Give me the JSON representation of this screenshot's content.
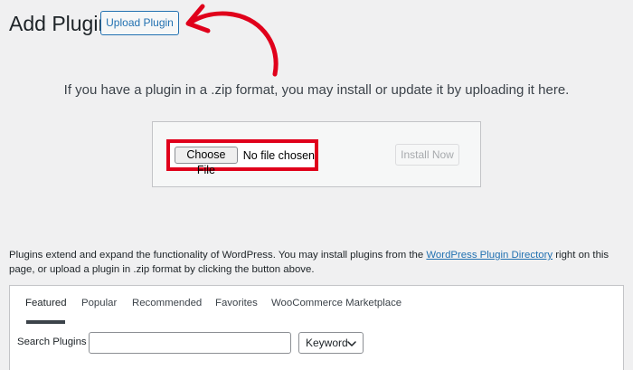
{
  "header": {
    "title": "Add Plugins",
    "upload_button": "Upload Plugin"
  },
  "upload": {
    "description": "If you have a plugin in a .zip format, you may install or update it by uploading it here.",
    "choose_file": "Choose File",
    "no_file": "No file chosen",
    "install_button": "Install Now"
  },
  "info": {
    "text_before": "Plugins extend and expand the functionality of WordPress. You may install plugins from the ",
    "link": "WordPress Plugin Directory",
    "text_after": " right on this page, or upload a plugin in .zip format by clicking the button above."
  },
  "tabs": [
    {
      "label": "Featured",
      "active": true
    },
    {
      "label": "Popular"
    },
    {
      "label": "Recommended"
    },
    {
      "label": "Favorites"
    },
    {
      "label": "WooCommerce Marketplace"
    }
  ],
  "search": {
    "label": "Search Plugins",
    "value": "",
    "type_selected": "Keyword"
  },
  "colors": {
    "accent": "#2271b1",
    "highlight": "#e0001b",
    "background": "#f0f0f1"
  },
  "icons": {
    "annotation_arrow": "curved-arrow-icon",
    "select_chevron": "chevron-down-icon"
  }
}
